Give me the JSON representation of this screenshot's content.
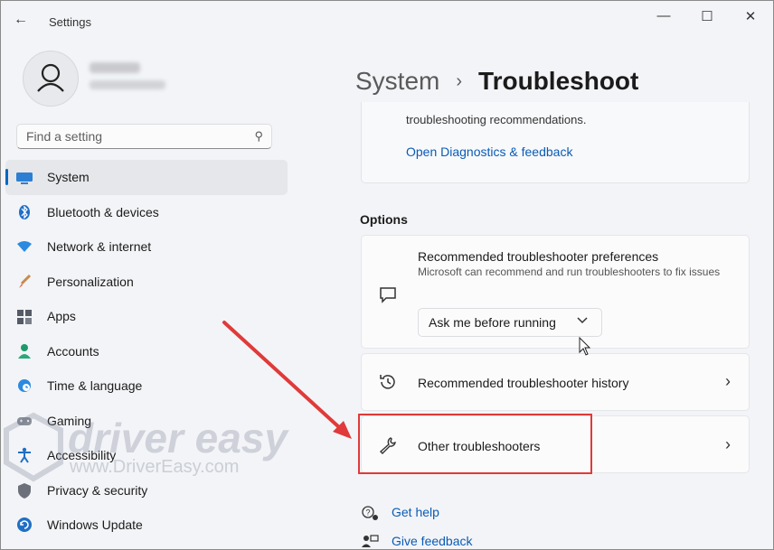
{
  "window": {
    "title": "Settings",
    "back_glyph": "←",
    "min_glyph": "—",
    "max_glyph": "☐",
    "close_glyph": "✕"
  },
  "search": {
    "placeholder": "Find a setting",
    "icon": "search-icon"
  },
  "nav": {
    "items": [
      {
        "label": "System",
        "icon": "system-icon",
        "active": true
      },
      {
        "label": "Bluetooth & devices",
        "icon": "bluetooth-icon"
      },
      {
        "label": "Network & internet",
        "icon": "wifi-icon"
      },
      {
        "label": "Personalization",
        "icon": "brush-icon"
      },
      {
        "label": "Apps",
        "icon": "apps-icon"
      },
      {
        "label": "Accounts",
        "icon": "person-icon"
      },
      {
        "label": "Time & language",
        "icon": "globe-clock-icon"
      },
      {
        "label": "Gaming",
        "icon": "gamepad-icon"
      },
      {
        "label": "Accessibility",
        "icon": "accessibility-icon"
      },
      {
        "label": "Privacy & security",
        "icon": "shield-icon"
      },
      {
        "label": "Windows Update",
        "icon": "update-icon"
      }
    ]
  },
  "breadcrumb": {
    "parent": "System",
    "separator": "›",
    "current": "Troubleshoot"
  },
  "top_card": {
    "text": "troubleshooting recommendations.",
    "link": "Open Diagnostics & feedback"
  },
  "options": {
    "heading": "Options",
    "preferences": {
      "title": "Recommended troubleshooter preferences",
      "description": "Microsoft can recommend and run troubleshooters to fix issues",
      "dropdown_value": "Ask me before running",
      "dropdown_chevron": "⌄",
      "icon": "chat-bubble-icon"
    },
    "history": {
      "title": "Recommended troubleshooter history",
      "chevron": "›",
      "icon": "history-icon"
    },
    "other": {
      "title": "Other troubleshooters",
      "chevron": "›",
      "icon": "wrench-icon"
    }
  },
  "help_links": {
    "get_help": "Get help",
    "give_feedback": "Give feedback"
  },
  "watermark": {
    "brand": "driver easy",
    "url": "www.DriverEasy.com"
  },
  "colors": {
    "accent": "#0067c0",
    "link": "#0a5bb5",
    "annotation": "#e03a3a"
  }
}
